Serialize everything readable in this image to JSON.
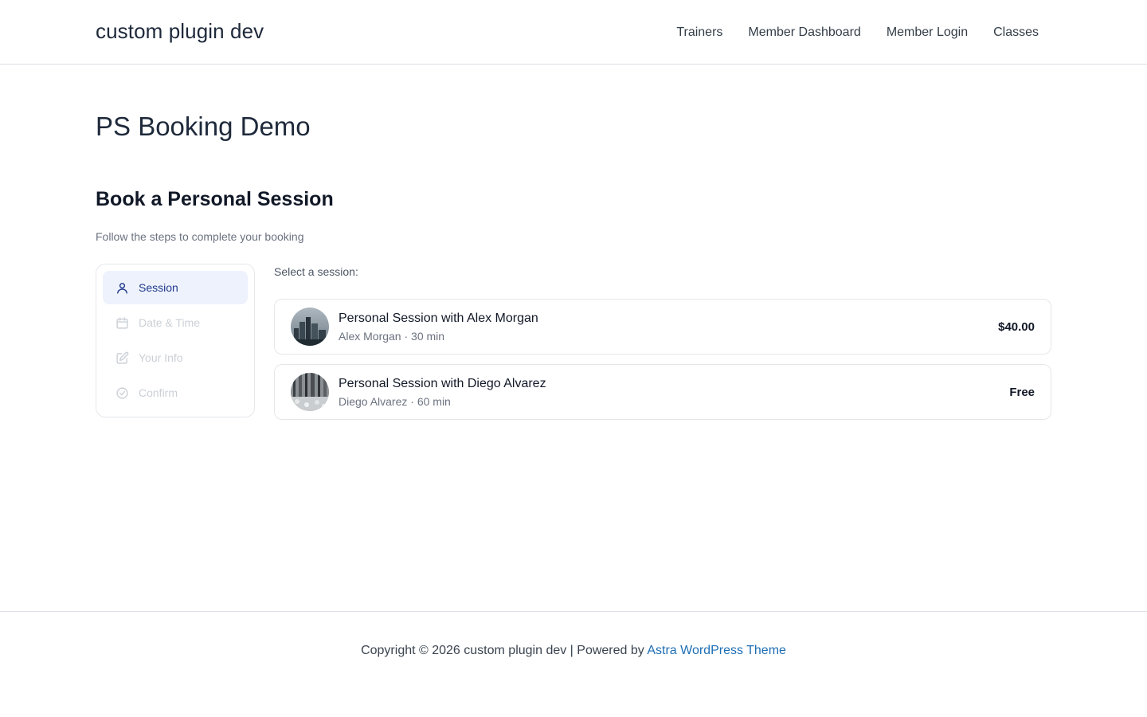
{
  "header": {
    "site_title": "custom plugin dev",
    "nav": [
      "Trainers",
      "Member Dashboard",
      "Member Login",
      "Classes"
    ]
  },
  "page": {
    "title": "PS Booking Demo"
  },
  "booking": {
    "heading": "Book a Personal Session",
    "subtitle": "Follow the steps to complete your booking",
    "steps": [
      {
        "label": "Session",
        "icon": "user-icon",
        "active": true
      },
      {
        "label": "Date & Time",
        "icon": "calendar-icon",
        "active": false
      },
      {
        "label": "Your Info",
        "icon": "edit-icon",
        "active": false
      },
      {
        "label": "Confirm",
        "icon": "check-circle-icon",
        "active": false
      }
    ],
    "select_label": "Select a session:",
    "sessions": [
      {
        "title": "Personal Session with Alex Morgan",
        "meta": "Alex Morgan · 30 min",
        "price": "$40.00"
      },
      {
        "title": "Personal Session with Diego Alvarez",
        "meta": "Diego Alvarez · 60 min",
        "price": "Free"
      }
    ]
  },
  "footer": {
    "text": "Copyright © 2026 custom plugin dev | Powered by ",
    "link": "Astra WordPress Theme"
  },
  "colors": {
    "accent": "#1e3a8a",
    "active_step_bg": "#eef2fd",
    "link": "#1f6fb5"
  }
}
